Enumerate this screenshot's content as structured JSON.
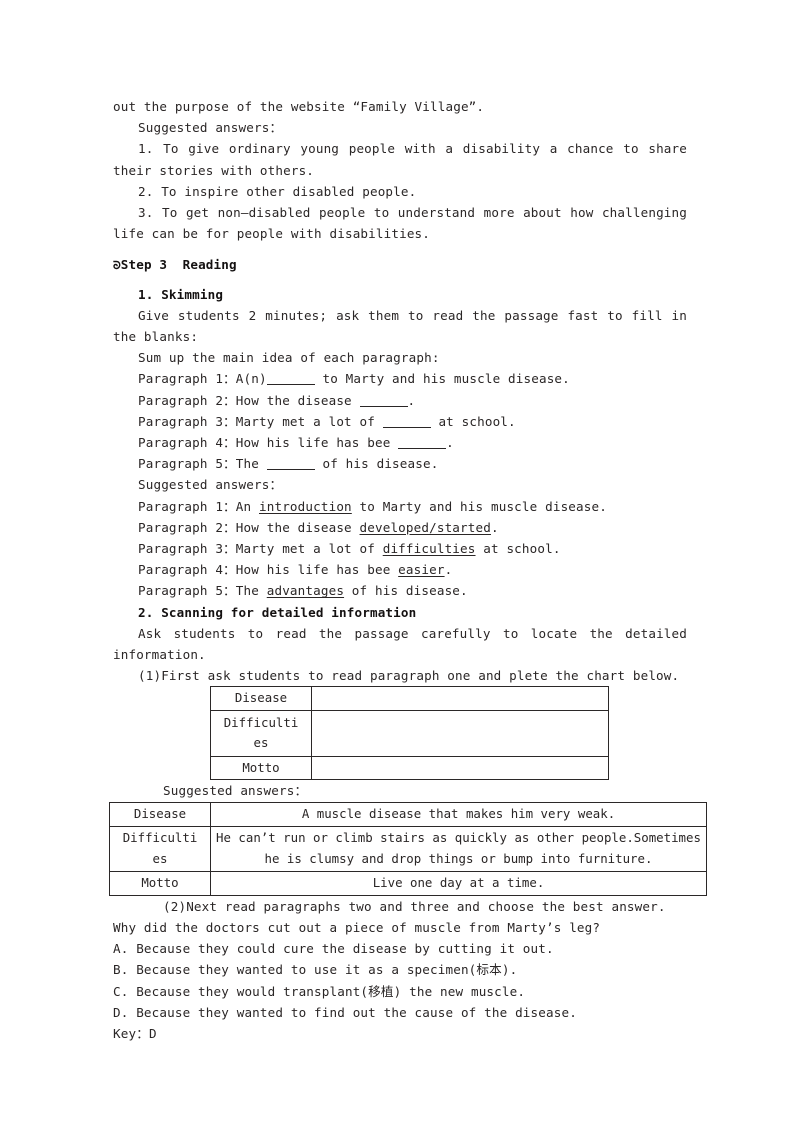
{
  "document": {
    "intro": {
      "carryover_line": "out the purpose of the website “Family Village”.",
      "suggested_label": "Suggested answers：",
      "answers": [
        "1. To give ordinary young people with a disability a chance to share their stories with others.",
        "2. To inspire other disabled people.",
        "3. To get non—disabled people to understand more about how challenging life can be for people with disabilities."
      ]
    },
    "step3": {
      "marker": "ᘐ",
      "heading": "Step 3  Reading",
      "skimming": {
        "heading": "1. Skimming",
        "instruction": "Give students 2 minutes; ask them to read the passage fast to fill in the blanks:",
        "prompt": "Sum up the main idea of each paragraph:",
        "blanks": [
          {
            "label": "Paragraph 1：",
            "before": "A(n)",
            "after": " to Marty and his muscle disease."
          },
          {
            "label": "Paragraph 2：",
            "before": "How the disease ",
            "after": "."
          },
          {
            "label": "Paragraph 3：",
            "before": "Marty met a lot of ",
            "after": " at school."
          },
          {
            "label": "Paragraph 4：",
            "before": "How his life has bee ",
            "after": "."
          },
          {
            "label": "Paragraph 5：",
            "before": "The ",
            "after": " of his disease."
          }
        ],
        "suggested_label": "Suggested answers：",
        "answers": [
          {
            "label": "Paragraph 1：",
            "before": "An ",
            "answer": "introduction",
            "after": " to Marty and his muscle disease."
          },
          {
            "label": "Paragraph 2：",
            "before": "How the disease ",
            "answer": "developed/started",
            "after": "."
          },
          {
            "label": "Paragraph 3：",
            "before": "Marty met a lot of ",
            "answer": "difficulties",
            "after": " at school."
          },
          {
            "label": "Paragraph 4：",
            "before": "How his life has bee ",
            "answer": "easier",
            "after": "."
          },
          {
            "label": "Paragraph 5：",
            "before": "The ",
            "answer": "advantages",
            "after": " of his disease."
          }
        ]
      },
      "scanning": {
        "heading": "2. Scanning for detailed information",
        "instruction": "Ask students to read the passage carefully to locate the detailed information.",
        "task1": "(1)First ask students to read paragraph one and plete the chart below.",
        "chart_blank": {
          "rows": [
            {
              "label": "Disease",
              "value": ""
            },
            {
              "label": "Difficulti\nes",
              "value": ""
            },
            {
              "label": "Motto",
              "value": ""
            }
          ]
        },
        "suggested_label": "Suggested answers：",
        "chart_filled": {
          "rows": [
            {
              "label": "Disease",
              "value": "A muscle disease that makes him very weak."
            },
            {
              "label": "Difficulti\nes",
              "value": "He can’t run or climb stairs as quickly as other people.Sometimes\nhe is clumsy and drop things or bump into furniture."
            },
            {
              "label": "Motto",
              "value": "Live one day at a time."
            }
          ]
        },
        "task2": "(2)Next read paragraphs two and three and choose the best answer.",
        "question": "Why did the doctors cut out a piece of muscle from Marty’s leg?",
        "options": [
          "A. Because they could cure the disease by cutting it out.",
          "B. Because they wanted to use it as a specimen(标本).",
          "C. Because they would transplant(移植) the new muscle.",
          "D. Because they wanted to find out the cause of the disease."
        ],
        "key": "Key：D"
      }
    }
  }
}
